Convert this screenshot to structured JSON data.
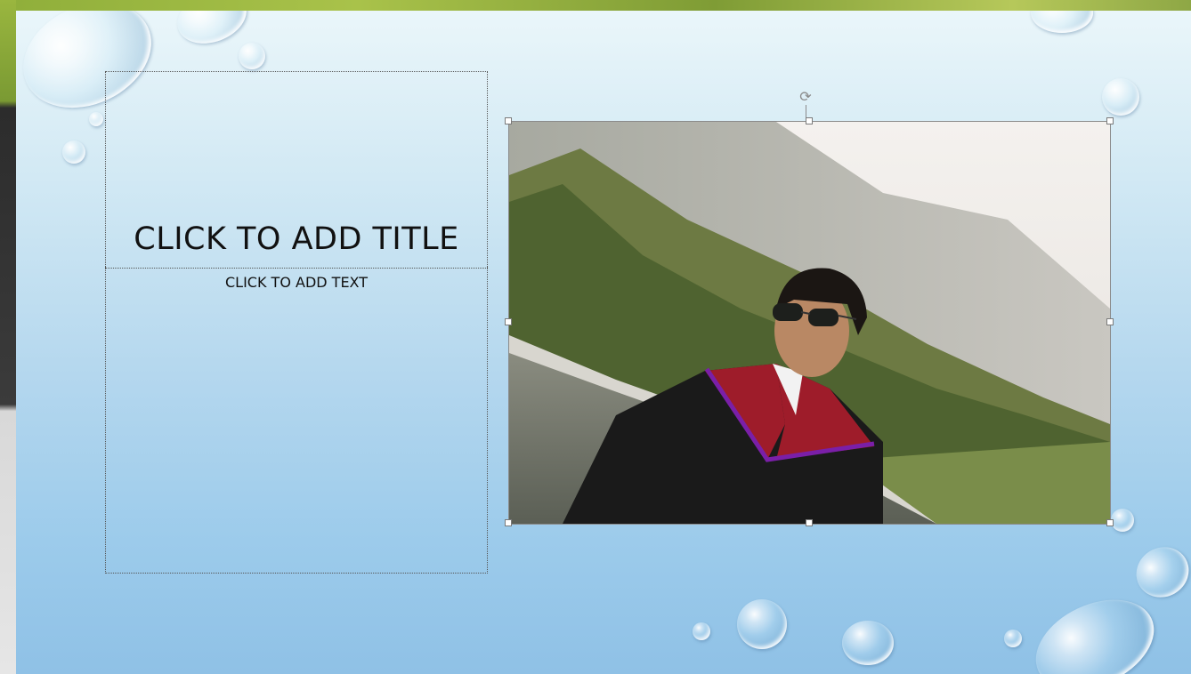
{
  "slide": {
    "title_placeholder": "CLICK TO ADD TITLE",
    "text_placeholder": "CLICK TO ADD TEXT"
  },
  "picture": {
    "description_icon": "graduate-photo",
    "selected": true
  },
  "icons": {
    "rotate": "rotate-icon"
  },
  "colors": {
    "slide_top": "#eaf6fa",
    "slide_bottom": "#8fc1e6",
    "gown": "#1a1a1a",
    "hood_red": "#9e1c2a",
    "hood_purple": "#7a1fa8"
  }
}
